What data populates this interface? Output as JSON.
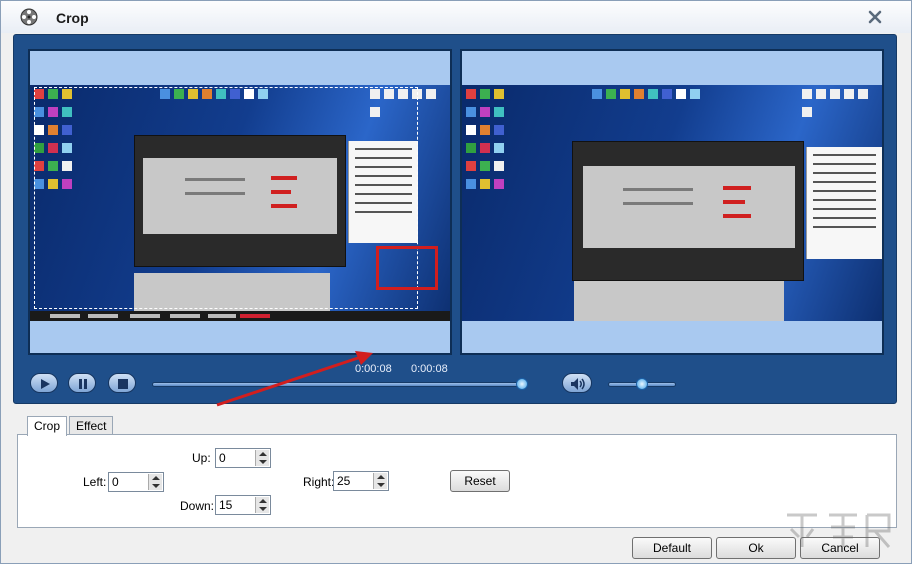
{
  "window": {
    "title": "Crop",
    "app_icon": "film-reel-icon",
    "close_icon": "close-icon"
  },
  "player": {
    "elapsed_time": "0:00:08",
    "total_time": "0:00:08",
    "controls": {
      "play_icon": "play-icon",
      "pause_icon": "pause-icon",
      "stop_icon": "stop-icon",
      "volume_icon": "speaker-icon"
    },
    "progress": 1.0,
    "volume": 0.5
  },
  "tabs": [
    {
      "label": "Crop",
      "active": true
    },
    {
      "label": "Effect",
      "active": false
    }
  ],
  "crop": {
    "up_label": "Up:",
    "up_value": "0",
    "left_label": "Left:",
    "left_value": "0",
    "right_label": "Right:",
    "right_value": "25",
    "down_label": "Down:",
    "down_value": "15",
    "reset_label": "Reset"
  },
  "footer": {
    "default_label": "Default",
    "ok_label": "Ok",
    "cancel_label": "Cancel"
  },
  "colors": {
    "player_bg": "#1f4f8a",
    "highlight_red": "#d21e1e"
  }
}
